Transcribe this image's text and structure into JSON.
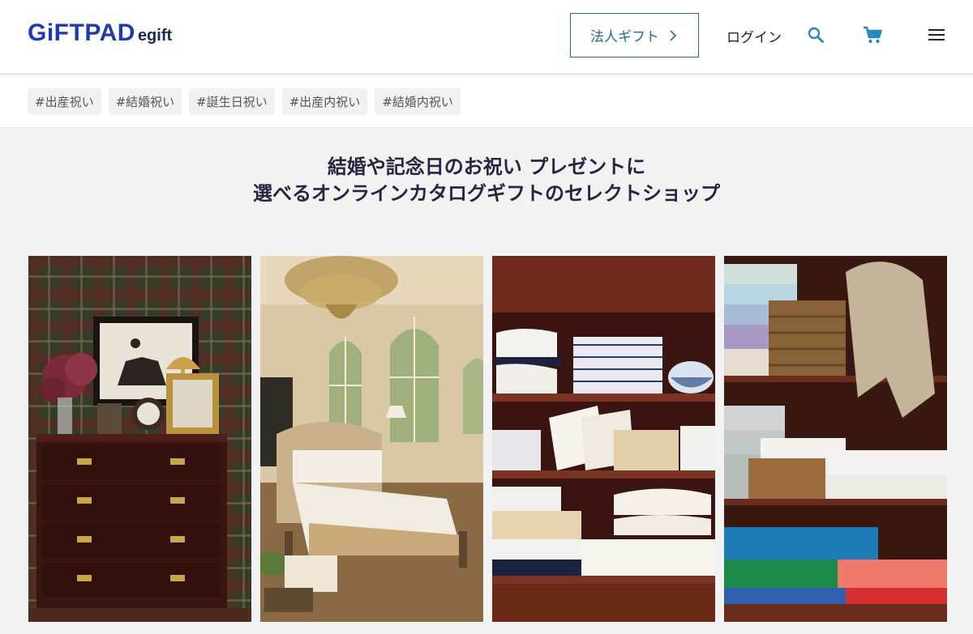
{
  "header": {
    "logo_main": "GiFTPAD",
    "logo_sub": "egift",
    "corporate_gift_label": "法人ギフト",
    "login_label": "ログイン",
    "icons": [
      "search-icon",
      "cart-icon",
      "menu-icon"
    ],
    "accent_color": "#1f6f8b",
    "brand_color": "#1d3bb3"
  },
  "tags": [
    "#出産祝い",
    "#結婚祝い",
    "#誕生日祝い",
    "#出産内祝い",
    "#結婚内祝い"
  ],
  "hero": {
    "line1": "結婚や記念日のお祝い プレゼントに",
    "line2": "選べるオンラインカタログギフトのセレクトショップ"
  },
  "gallery": {
    "photos": [
      "bedroom-dresser-photo",
      "canopy-bedroom-photo",
      "bedding-shelf-photo",
      "towel-shelf-photo"
    ]
  }
}
